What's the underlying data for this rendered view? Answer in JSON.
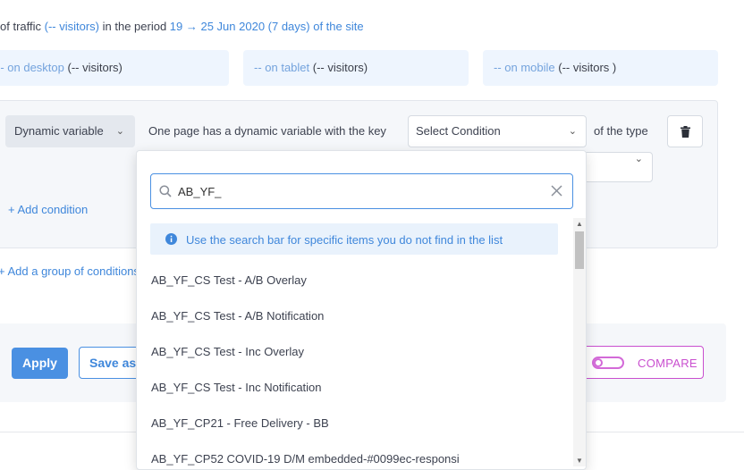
{
  "summary": {
    "prefix": "of traffic ",
    "visitors": "(-- visitors)",
    "middle": " in the period ",
    "period": "19 → 25 Jun 2020 (7 days) of the site"
  },
  "devices": [
    {
      "label": "-- on desktop ",
      "count": "(-- visitors)"
    },
    {
      "label": "-- on tablet ",
      "count": "(-- visitors)"
    },
    {
      "label": "-- on mobile ",
      "count": "(-- visitors )"
    }
  ],
  "condition": {
    "variable_button": "Dynamic variable",
    "text": "One page has a dynamic variable with the key",
    "select_placeholder": "Select Condition",
    "of_type": "of the type",
    "add_condition": "+ Add condition",
    "add_group": "+ Add a group of conditions"
  },
  "actions": {
    "apply": "Apply",
    "save_as": "Save as",
    "compare": "COMPARE"
  },
  "dropdown": {
    "search_value": "AB_YF_",
    "info": "Use the search bar for specific items you do not find in the list",
    "options": [
      "AB_YF_CS Test - A/B Overlay",
      "AB_YF_CS Test - A/B Notification",
      "AB_YF_CS Test - Inc Overlay",
      "AB_YF_CS Test - Inc Notification",
      "AB_YF_CP21 - Free Delivery - BB",
      "AB_YF_CP52 COVID-19 D/M embedded-#0099ec-responsi"
    ]
  },
  "colors": {
    "accent": "#4a90e2",
    "compare": "#c94fcf",
    "panel": "#f5f7fa"
  }
}
